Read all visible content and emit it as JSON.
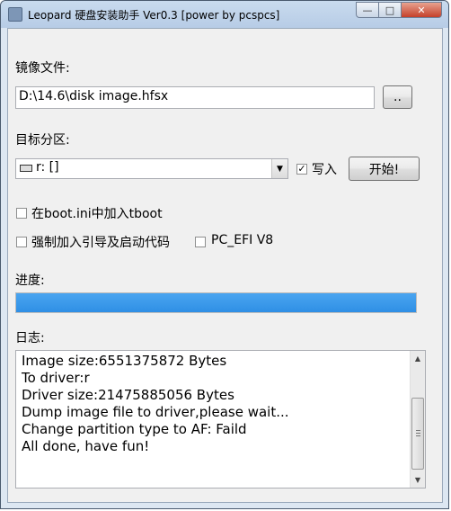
{
  "window": {
    "title": "Leopard 硬盘安装助手 Ver0.3 [power by pcspcs]",
    "controls": {
      "minimize": "—",
      "maximize": "□",
      "close": "✕"
    }
  },
  "image_file": {
    "label": "镜像文件:",
    "value": "D:\\14.6\\disk image.hfsx",
    "browse_label": ".."
  },
  "target_partition": {
    "label": "目标分区:",
    "selected": "r: []",
    "dropdown_icon": "▼",
    "write_checked": true,
    "write_label": "写入",
    "start_label": "开始!"
  },
  "options": {
    "tboot_checked": false,
    "tboot_label": "在boot.ini中加入tboot",
    "force_checked": false,
    "force_label": "强制加入引导及启动代码",
    "pcefi_checked": false,
    "pcefi_label": "PC_EFI V8"
  },
  "progress": {
    "label": "进度:",
    "fraction": 1.0
  },
  "log": {
    "label": "日志:",
    "lines": [
      "Image size:6551375872 Bytes",
      "To driver:r",
      "Driver size:21475885056 Bytes",
      "Dump image file to driver,please wait...",
      "Change partition type to AF: Faild",
      "All done, have fun!"
    ],
    "scroll_up": "▲",
    "scroll_down": "▼"
  },
  "check_mark": "✓"
}
